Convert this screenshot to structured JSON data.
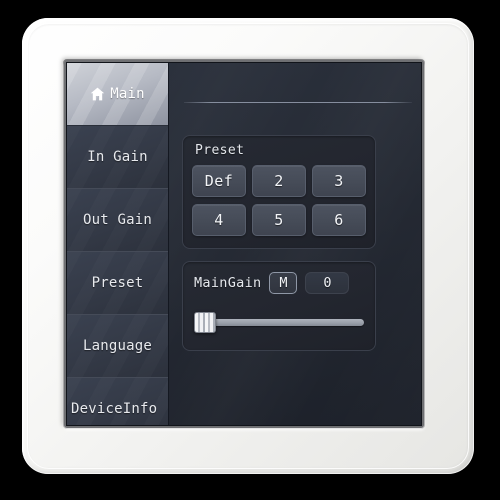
{
  "device": {
    "name": "wall-mounted-touch-panel",
    "bezel_color": "#f2f2f0",
    "screen_bg": "#262b35"
  },
  "sidebar": {
    "items": [
      {
        "id": "main",
        "label": "Main",
        "icon": "home-icon",
        "selected": true
      },
      {
        "id": "in-gain",
        "label": "In Gain",
        "icon": "",
        "selected": false
      },
      {
        "id": "out-gain",
        "label": "Out Gain",
        "icon": "",
        "selected": false
      },
      {
        "id": "preset",
        "label": "Preset",
        "icon": "",
        "selected": false
      },
      {
        "id": "language",
        "label": "Language",
        "icon": "",
        "selected": false
      },
      {
        "id": "deviceinfo",
        "label": "DeviceInfo",
        "icon": "",
        "selected": false
      }
    ]
  },
  "main": {
    "preset_panel": {
      "title": "Preset",
      "buttons": [
        {
          "label": "Def",
          "selected": false
        },
        {
          "label": "2",
          "selected": false
        },
        {
          "label": "3",
          "selected": false
        },
        {
          "label": "4",
          "selected": false
        },
        {
          "label": "5",
          "selected": false
        },
        {
          "label": "6",
          "selected": false
        }
      ]
    },
    "gain_panel": {
      "label": "MainGain",
      "mute_label": "M",
      "value": "0",
      "slider": {
        "position_percent": 0,
        "min": 0,
        "max": 100
      }
    }
  },
  "colors": {
    "accent_selected": "#b6bac4",
    "panel_bg": "#23262f",
    "button_bg": "#464c58",
    "text": "#e8eaee",
    "track": "#9aa0aa"
  }
}
